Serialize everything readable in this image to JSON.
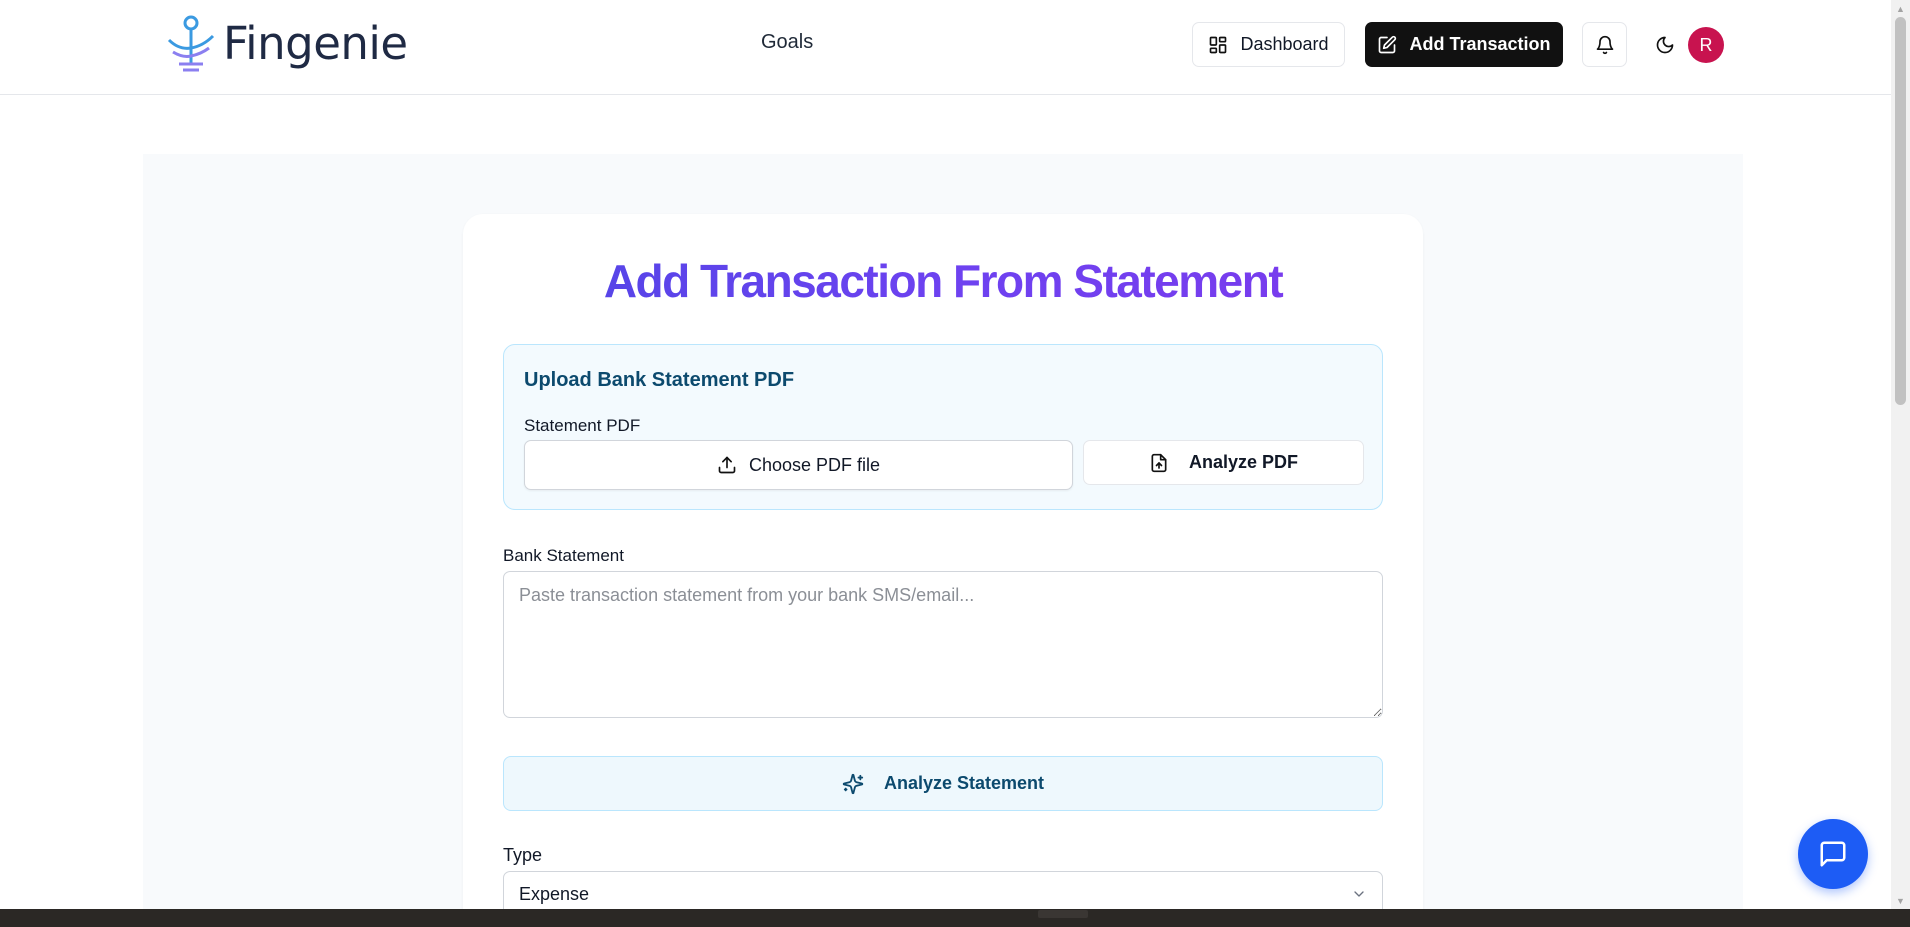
{
  "brand": {
    "name": "Fingenie"
  },
  "nav": {
    "goals": "Goals"
  },
  "header": {
    "dashboard_label": "Dashboard",
    "add_transaction_label": "Add Transaction",
    "avatar_initial": "R"
  },
  "page": {
    "title": "Add Transaction From Statement"
  },
  "upload": {
    "title": "Upload Bank Statement PDF",
    "field_label": "Statement PDF",
    "choose_label": "Choose PDF file",
    "analyze_label": "Analyze PDF"
  },
  "statement": {
    "label": "Bank Statement",
    "placeholder": "Paste transaction statement from your bank SMS/email...",
    "value": ""
  },
  "analyze_statement_label": "Analyze Statement",
  "type": {
    "label": "Type",
    "selected": "Expense"
  },
  "colors": {
    "primary_dark": "#111111",
    "accent_gradient_start": "#4f46e5",
    "accent_gradient_end": "#7c3aed",
    "info_text": "#0c4a6e",
    "avatar_bg": "#c8134f",
    "chat_fab": "#1d5cf5"
  },
  "icons": {
    "dashboard": "layout-grid-icon",
    "add_transaction": "edit-icon",
    "notifications": "bell-icon",
    "theme": "moon-icon",
    "upload": "upload-icon",
    "analyze_pdf": "file-upload-icon",
    "analyze_statement": "sparkles-icon",
    "select": "chevron-down-icon",
    "chat": "chat-bubble-icon"
  }
}
